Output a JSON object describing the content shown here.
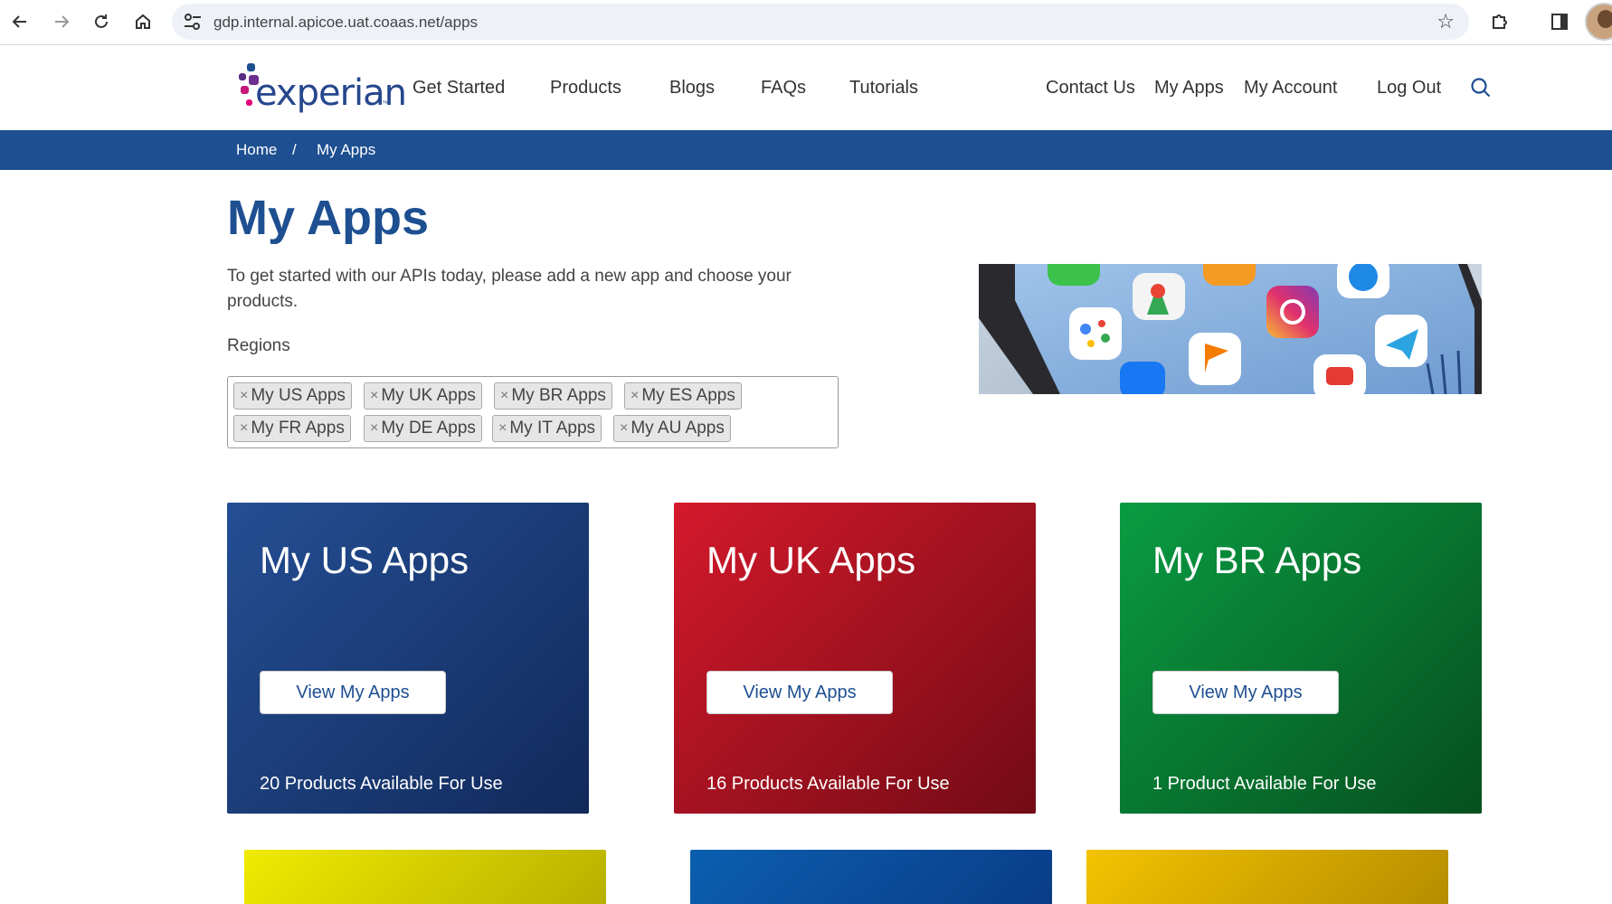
{
  "browser": {
    "url": "gdp.internal.apicoe.uat.coaas.net/apps"
  },
  "header": {
    "logo_text": "experian",
    "logo_tm": "™",
    "nav_left": [
      "Get Started",
      "Products",
      "Blogs",
      "FAQs",
      "Tutorials"
    ],
    "nav_right": [
      "Contact Us",
      "My Apps",
      "My Account",
      "Log Out"
    ]
  },
  "breadcrumb": {
    "home": "Home",
    "separator": "/",
    "current": "My Apps"
  },
  "main": {
    "title": "My Apps",
    "intro": "To get started with our APIs today, please add a new app and choose your products.",
    "regions_label": "Regions",
    "region_tags": [
      "My US Apps",
      "My UK Apps",
      "My BR Apps",
      "My ES Apps",
      "My FR Apps",
      "My DE Apps",
      "My IT Apps",
      "My AU Apps"
    ],
    "tag_remove_glyph": "×"
  },
  "cards": [
    {
      "title": "My US Apps",
      "button": "View My Apps",
      "footer": "20 Products Available For Use",
      "color": "#1d4f91"
    },
    {
      "title": "My UK Apps",
      "button": "View My Apps",
      "footer": "16 Products Available For Use",
      "color": "#c8102e"
    },
    {
      "title": "My BR Apps",
      "button": "View My Apps",
      "footer": "1 Product Available For Use",
      "color": "#00903a"
    }
  ],
  "colors": {
    "brand_blue": "#1d4f91",
    "logo_dots": [
      "#5a2d82",
      "#1d4f91",
      "#c8177a",
      "#e4007c",
      "#26478d"
    ]
  },
  "icons": {
    "back": "arrow-left-icon",
    "forward": "arrow-right-icon",
    "reload": "reload-icon",
    "home": "home-icon",
    "site_info": "tune-icon",
    "bookmark": "star-icon",
    "extensions": "puzzle-icon",
    "side_panel": "side-panel-icon",
    "search": "search-icon"
  }
}
